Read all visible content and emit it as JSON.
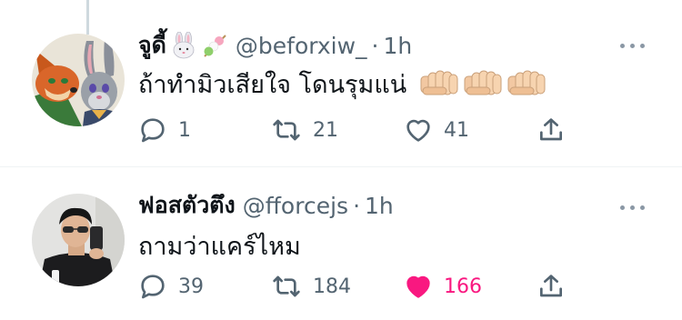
{
  "tweets": [
    {
      "display_name": "จูดี้",
      "name_emojis": [
        "rabbit-face-emoji",
        "dango-emoji"
      ],
      "handle": "@beforxiw_",
      "separator": "·",
      "time": "1h",
      "text": "ถ้าทำมิวเสียใจ โดนรุมแน่",
      "text_emojis": [
        "fist-emoji",
        "fist-emoji",
        "fist-emoji"
      ],
      "reply_count": "1",
      "retweet_count": "21",
      "like_count": "41",
      "liked": false
    },
    {
      "display_name": "ฟอสตัวตึง",
      "handle": "@fforcejs",
      "separator": "·",
      "time": "1h",
      "text": "ถามว่าแคร์ไหม",
      "reply_count": "39",
      "retweet_count": "184",
      "like_count": "166",
      "liked": true
    }
  ],
  "colors": {
    "text": "#0f1419",
    "secondary": "#536471",
    "like_active": "#f91880",
    "divider": "#eff3f4",
    "thread_line": "#cfd9de"
  }
}
